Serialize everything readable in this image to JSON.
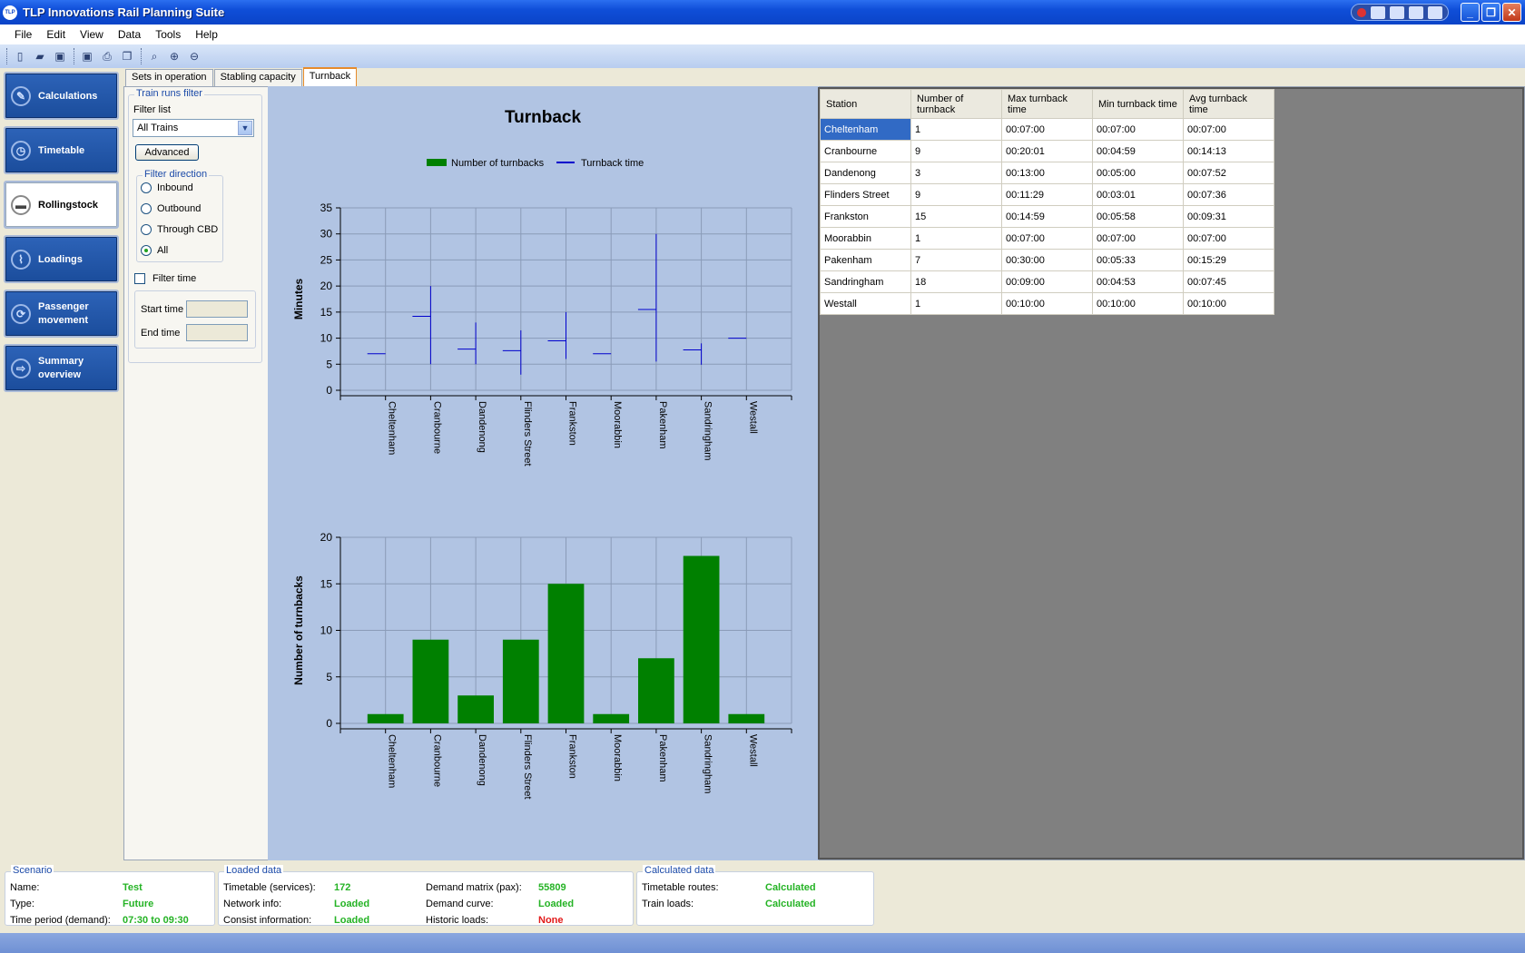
{
  "window": {
    "title": "TLP Innovations Rail Planning Suite",
    "logo": "TLP"
  },
  "menu": [
    "File",
    "Edit",
    "View",
    "Data",
    "Tools",
    "Help"
  ],
  "toolbar_icons": [
    "new-icon",
    "open-icon",
    "save-icon",
    "save-all-icon",
    "print-icon",
    "copy-icon",
    "search-icon",
    "zoom-in-icon",
    "zoom-out-icon"
  ],
  "nav": [
    {
      "label": "Calculations",
      "icon": "calculator-icon"
    },
    {
      "label": "Timetable",
      "icon": "clock-icon"
    },
    {
      "label": "Rollingstock",
      "icon": "train-icon",
      "active": true
    },
    {
      "label": "Loadings",
      "icon": "chart-icon"
    },
    {
      "label": "Passenger movement",
      "icon": "cycle-icon"
    },
    {
      "label": "Summary overview",
      "icon": "arrow-icon"
    }
  ],
  "tabs": [
    {
      "label": "Sets in operation"
    },
    {
      "label": "Stabling capacity"
    },
    {
      "label": "Turnback",
      "active": true
    }
  ],
  "filter": {
    "group_title": "Train runs filter",
    "filter_list_label": "Filter list",
    "filter_list_value": "All Trains",
    "advanced_label": "Advanced",
    "direction_title": "Filter direction",
    "directions": [
      "Inbound",
      "Outbound",
      "Through CBD",
      "All"
    ],
    "selected_direction": "All",
    "filter_time_label": "Filter time",
    "start_time_label": "Start time",
    "end_time_label": "End time"
  },
  "chart_data": [
    {
      "type": "line",
      "title": "Turnback",
      "legend": [
        "Number of turnbacks",
        "Turnback time"
      ],
      "legend_position": "top",
      "ylabel": "Minutes",
      "ylim": [
        0,
        35
      ],
      "yticks": [
        0,
        5,
        10,
        15,
        20,
        25,
        30,
        35
      ],
      "categories": [
        "Cheltenham",
        "Cranbourne",
        "Dandenong",
        "Flinders Street",
        "Frankston",
        "Moorabbin",
        "Pakenham",
        "Sandringham",
        "Westall"
      ],
      "series": [
        {
          "name": "Turnback time",
          "max": [
            7.0,
            20.0,
            13.0,
            11.5,
            15.0,
            7.0,
            30.0,
            9.0,
            10.0
          ],
          "min": [
            7.0,
            5.0,
            5.0,
            3.0,
            6.0,
            7.0,
            5.5,
            4.9,
            10.0
          ],
          "avg": [
            7.0,
            14.2,
            7.9,
            7.6,
            9.5,
            7.0,
            15.5,
            7.75,
            10.0
          ]
        }
      ],
      "grid": true
    },
    {
      "type": "bar",
      "ylabel": "Number of turnbacks",
      "ylim": [
        0,
        20
      ],
      "yticks": [
        0,
        5,
        10,
        15,
        20
      ],
      "categories": [
        "Cheltenham",
        "Cranbourne",
        "Dandenong",
        "Flinders Street",
        "Frankston",
        "Moorabbin",
        "Pakenham",
        "Sandringham",
        "Westall"
      ],
      "series": [
        {
          "name": "Number of turnbacks",
          "values": [
            1,
            9,
            3,
            9,
            15,
            1,
            7,
            18,
            1
          ]
        }
      ],
      "grid": true
    }
  ],
  "colors": {
    "bar": "#008000",
    "line": "#0000cc",
    "chart_bg": "#b1c4e3",
    "selection": "#316ac5"
  },
  "table": {
    "headers": [
      "Station",
      "Number of turnback",
      "Max turnback time",
      "Min turnback time",
      "Avg turnback time"
    ],
    "rows": [
      [
        "Cheltenham",
        "1",
        "00:07:00",
        "00:07:00",
        "00:07:00"
      ],
      [
        "Cranbourne",
        "9",
        "00:20:01",
        "00:04:59",
        "00:14:13"
      ],
      [
        "Dandenong",
        "3",
        "00:13:00",
        "00:05:00",
        "00:07:52"
      ],
      [
        "Flinders Street",
        "9",
        "00:11:29",
        "00:03:01",
        "00:07:36"
      ],
      [
        "Frankston",
        "15",
        "00:14:59",
        "00:05:58",
        "00:09:31"
      ],
      [
        "Moorabbin",
        "1",
        "00:07:00",
        "00:07:00",
        "00:07:00"
      ],
      [
        "Pakenham",
        "7",
        "00:30:00",
        "00:05:33",
        "00:15:29"
      ],
      [
        "Sandringham",
        "18",
        "00:09:00",
        "00:04:53",
        "00:07:45"
      ],
      [
        "Westall",
        "1",
        "00:10:00",
        "00:10:00",
        "00:10:00"
      ]
    ]
  },
  "status": {
    "scenario": {
      "title": "Scenario",
      "name_label": "Name:",
      "name": "Test",
      "type_label": "Type:",
      "type": "Future",
      "period_label": "Time period (demand):",
      "period": "07:30 to 09:30"
    },
    "loaded": {
      "title": "Loaded data",
      "timetable_label": "Timetable (services):",
      "timetable": "172",
      "network_label": "Network info:",
      "network": "Loaded",
      "consist_label": "Consist information:",
      "consist": "Loaded",
      "demand_label": "Demand matrix (pax):",
      "demand": "55809",
      "curve_label": "Demand curve:",
      "curve": "Loaded",
      "historic_label": "Historic loads:",
      "historic": "None"
    },
    "calculated": {
      "title": "Calculated data",
      "routes_label": "Timetable routes:",
      "routes": "Calculated",
      "loads_label": "Train loads:",
      "loads": "Calculated"
    }
  }
}
